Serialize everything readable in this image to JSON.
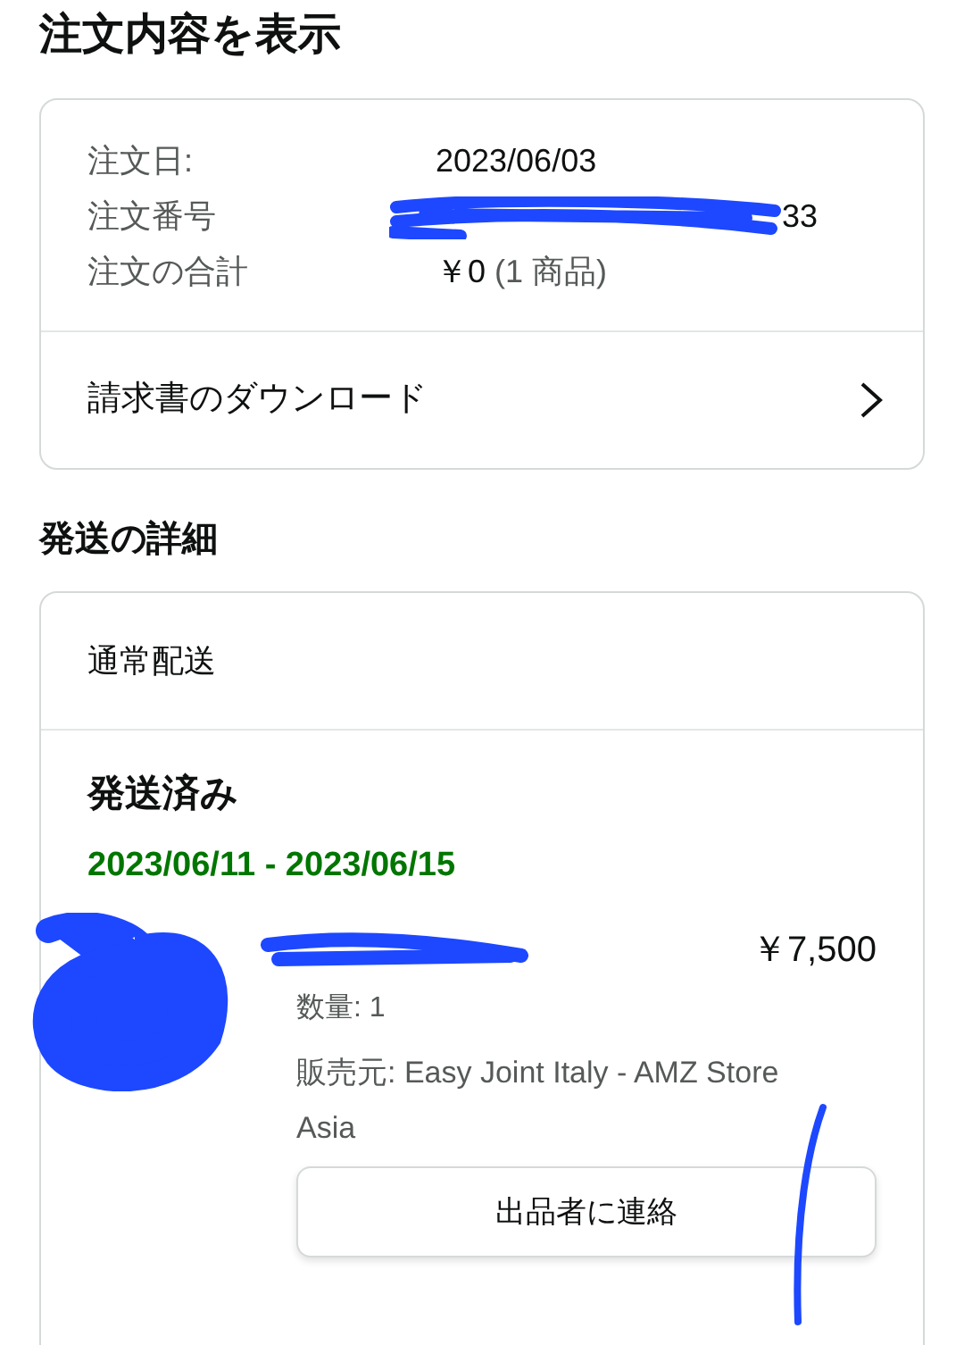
{
  "page_title": "注文内容を表示",
  "order_summary": {
    "rows": [
      {
        "label": "注文日:",
        "value": "2023/06/03"
      },
      {
        "label": "注文番号",
        "value": "33",
        "redacted": true
      },
      {
        "label": "注文の合計",
        "value": "￥0",
        "note": "(1 商品)"
      }
    ],
    "invoice_link": "請求書のダウンロード"
  },
  "shipping_title": "発送の詳細",
  "shipment": {
    "method": "通常配送",
    "status": "発送済み",
    "delivery_dates": "2023/06/11 - 2023/06/15",
    "item": {
      "price": "￥7,500",
      "quantity": "数量: 1",
      "seller": "販売元: Easy Joint Italy - AMZ Store Asia",
      "contact_button": "出品者に連絡"
    }
  }
}
